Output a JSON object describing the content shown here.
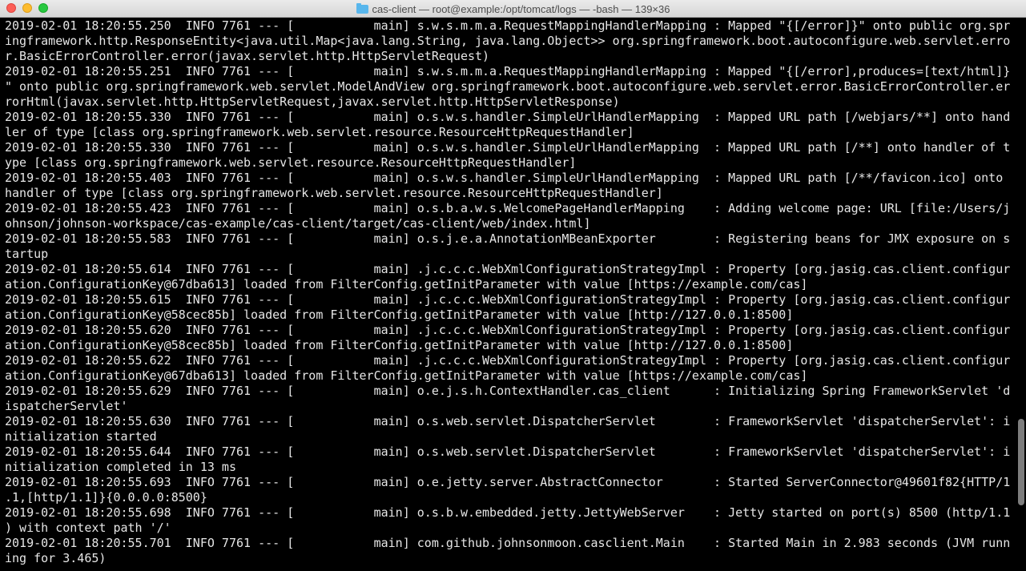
{
  "window": {
    "title": "cas-client — root@example:/opt/tomcat/logs — -bash — 139×36",
    "icon": "folder-icon"
  },
  "terminal": {
    "lines": [
      "2019-02-01 18:20:55.250  INFO 7761 --- [           main] s.w.s.m.m.a.RequestMappingHandlerMapping : Mapped \"{[/error]}\" onto public org.spr",
      "ingframework.http.ResponseEntity<java.util.Map<java.lang.String, java.lang.Object>> org.springframework.boot.autoconfigure.web.servlet.erro",
      "r.BasicErrorController.error(javax.servlet.http.HttpServletRequest)",
      "2019-02-01 18:20:55.251  INFO 7761 --- [           main] s.w.s.m.m.a.RequestMappingHandlerMapping : Mapped \"{[/error],produces=[text/html]}",
      "\" onto public org.springframework.web.servlet.ModelAndView org.springframework.boot.autoconfigure.web.servlet.error.BasicErrorController.er",
      "rorHtml(javax.servlet.http.HttpServletRequest,javax.servlet.http.HttpServletResponse)",
      "2019-02-01 18:20:55.330  INFO 7761 --- [           main] o.s.w.s.handler.SimpleUrlHandlerMapping  : Mapped URL path [/webjars/**] onto hand",
      "ler of type [class org.springframework.web.servlet.resource.ResourceHttpRequestHandler]",
      "2019-02-01 18:20:55.330  INFO 7761 --- [           main] o.s.w.s.handler.SimpleUrlHandlerMapping  : Mapped URL path [/**] onto handler of t",
      "ype [class org.springframework.web.servlet.resource.ResourceHttpRequestHandler]",
      "2019-02-01 18:20:55.403  INFO 7761 --- [           main] o.s.w.s.handler.SimpleUrlHandlerMapping  : Mapped URL path [/**/favicon.ico] onto",
      "handler of type [class org.springframework.web.servlet.resource.ResourceHttpRequestHandler]",
      "2019-02-01 18:20:55.423  INFO 7761 --- [           main] o.s.b.a.w.s.WelcomePageHandlerMapping    : Adding welcome page: URL [file:/Users/j",
      "ohnson/johnson-workspace/cas-example/cas-client/target/cas-client/web/index.html]",
      "2019-02-01 18:20:55.583  INFO 7761 --- [           main] o.s.j.e.a.AnnotationMBeanExporter        : Registering beans for JMX exposure on s",
      "tartup",
      "2019-02-01 18:20:55.614  INFO 7761 --- [           main] .j.c.c.c.WebXmlConfigurationStrategyImpl : Property [org.jasig.cas.client.configur",
      "ation.ConfigurationKey@67dba613] loaded from FilterConfig.getInitParameter with value [https://example.com/cas]",
      "2019-02-01 18:20:55.615  INFO 7761 --- [           main] .j.c.c.c.WebXmlConfigurationStrategyImpl : Property [org.jasig.cas.client.configur",
      "ation.ConfigurationKey@58cec85b] loaded from FilterConfig.getInitParameter with value [http://127.0.0.1:8500]",
      "2019-02-01 18:20:55.620  INFO 7761 --- [           main] .j.c.c.c.WebXmlConfigurationStrategyImpl : Property [org.jasig.cas.client.configur",
      "ation.ConfigurationKey@58cec85b] loaded from FilterConfig.getInitParameter with value [http://127.0.0.1:8500]",
      "2019-02-01 18:20:55.622  INFO 7761 --- [           main] .j.c.c.c.WebXmlConfigurationStrategyImpl : Property [org.jasig.cas.client.configur",
      "ation.ConfigurationKey@67dba613] loaded from FilterConfig.getInitParameter with value [https://example.com/cas]",
      "2019-02-01 18:20:55.629  INFO 7761 --- [           main] o.e.j.s.h.ContextHandler.cas_client      : Initializing Spring FrameworkServlet 'd",
      "ispatcherServlet'",
      "2019-02-01 18:20:55.630  INFO 7761 --- [           main] o.s.web.servlet.DispatcherServlet        : FrameworkServlet 'dispatcherServlet': i",
      "nitialization started",
      "2019-02-01 18:20:55.644  INFO 7761 --- [           main] o.s.web.servlet.DispatcherServlet        : FrameworkServlet 'dispatcherServlet': i",
      "nitialization completed in 13 ms",
      "2019-02-01 18:20:55.693  INFO 7761 --- [           main] o.e.jetty.server.AbstractConnector       : Started ServerConnector@49601f82{HTTP/1",
      ".1,[http/1.1]}{0.0.0.0:8500}",
      "2019-02-01 18:20:55.698  INFO 7761 --- [           main] o.s.b.w.embedded.jetty.JettyWebServer    : Jetty started on port(s) 8500 (http/1.1",
      ") with context path '/'",
      "2019-02-01 18:20:55.701  INFO 7761 --- [           main] com.github.johnsonmoon.casclient.Main    : Started Main in 2.983 seconds (JVM runn",
      "ing for 3.465)"
    ]
  }
}
